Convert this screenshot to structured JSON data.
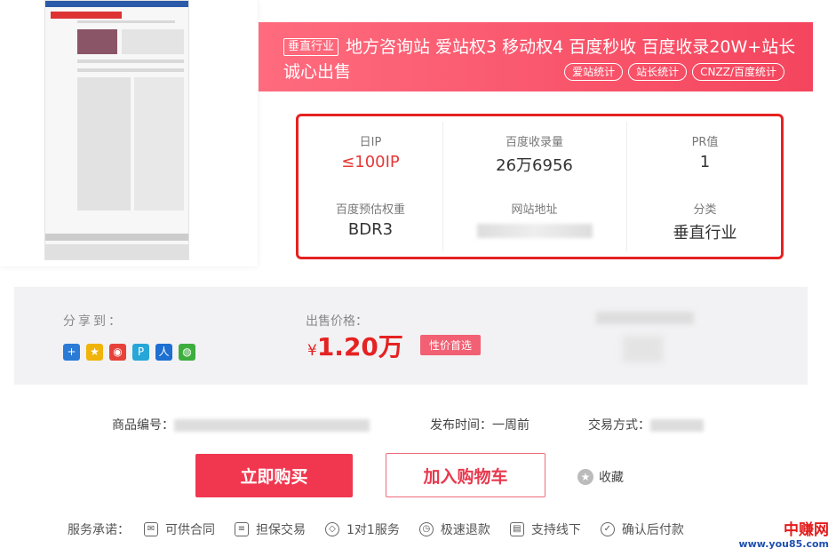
{
  "banner": {
    "tag": "垂直行业",
    "title": "地方咨询站 爱站权3 移动权4 百度秒收 百度收录20W+站长诚心出售",
    "chips": [
      "爱站统计",
      "站长统计",
      "CNZZ/百度统计"
    ]
  },
  "stats": {
    "daily_ip_label": "日IP",
    "daily_ip_value": "≤100IP",
    "baidu_index_label": "百度收录量",
    "baidu_index_value": "26万6956",
    "pr_label": "PR值",
    "pr_value": "1",
    "baidu_weight_label": "百度预估权重",
    "baidu_weight_value": "BDR3",
    "site_url_label": "网站地址",
    "category_label": "分类",
    "category_value": "垂直行业"
  },
  "share": {
    "label": "分享到：",
    "icons": [
      "plus-icon",
      "qzone-icon",
      "weibo-icon",
      "pengyou-icon",
      "renren-icon",
      "wechat-icon"
    ]
  },
  "price": {
    "label": "出售价格：",
    "currency": "¥",
    "amount": "1.20万",
    "badge": "性价首选"
  },
  "meta": {
    "product_no_label": "商品编号：",
    "publish_label": "发布时间：一周前",
    "trade_label": "交易方式："
  },
  "actions": {
    "buy": "立即购买",
    "cart": "加入购物车",
    "favorite": "收藏"
  },
  "service": {
    "label": "服务承诺：",
    "items": [
      "可供合同",
      "担保交易",
      "1对1服务",
      "极速退款",
      "支持线下",
      "确认后付款"
    ]
  },
  "watermark": {
    "name": "中赚网",
    "url": "www.you85.com"
  },
  "colors": {
    "accent": "#f1374f",
    "highlight_border": "#e52222"
  }
}
